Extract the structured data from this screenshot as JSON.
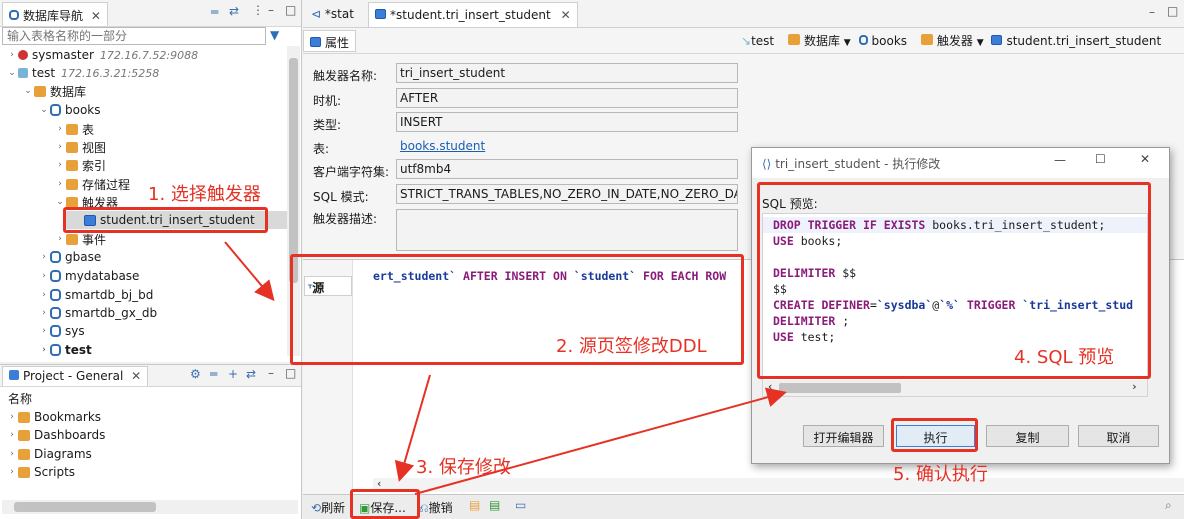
{
  "navigator": {
    "tab_title": "数据库导航",
    "filter_placeholder": "输入表格名称的一部分",
    "tree": {
      "sysmaster": {
        "name": "sysmaster",
        "host": "172.16.7.52:9088"
      },
      "test": {
        "name": "test",
        "host": "172.16.3.21:5258"
      },
      "databases": "数据库",
      "books": "books",
      "tables": "表",
      "views": "视图",
      "indexes": "索引",
      "procedures": "存储过程",
      "triggers": "触发器",
      "trigger_item": "student.tri_insert_student",
      "events": "事件",
      "other_dbs": [
        "gbase",
        "mydatabase",
        "smartdb_bj_bd",
        "smartdb_gx_db",
        "sys",
        "test"
      ]
    }
  },
  "project": {
    "tab_title": "Project - General",
    "column_header": "名称",
    "items": [
      "Bookmarks",
      "Dashboards",
      "Diagrams",
      "Scripts"
    ]
  },
  "editor": {
    "tabs": [
      "*stat",
      "*student.tri_insert_student"
    ],
    "subtab": "属性",
    "breadcrumb": {
      "conn": "test",
      "db_folder": "数据库",
      "db": "books",
      "trig_folder": "触发器",
      "trigger": "student.tri_insert_student"
    },
    "fields": {
      "name_label": "触发器名称:",
      "name_value": "tri_insert_student",
      "timing_label": "时机:",
      "timing_value": "AFTER",
      "type_label": "类型:",
      "type_value": "INSERT",
      "table_label": "表:",
      "table_value": "books.student",
      "charset_label": "客户端字符集:",
      "charset_value": "utf8mb4",
      "sqlmode_label": "SQL 模式:",
      "sqlmode_value": "STRICT_TRANS_TABLES,NO_ZERO_IN_DATE,NO_ZERO_DAT",
      "desc_label": "触发器描述:"
    },
    "source_tab": "源",
    "ddl_line": {
      "part1": "ert_student`",
      "part2": " AFTER INSERT ON ",
      "part3": "`student`",
      "part4": " FOR EACH ROW"
    },
    "toolbar": {
      "refresh": "刷新",
      "save": "保存...",
      "revert": "撤销"
    }
  },
  "dialog": {
    "title": "tri_insert_student - 执行修改",
    "preview_label": "SQL 预览:",
    "sql": {
      "l1_kw": "DROP TRIGGER IF EXISTS",
      "l1_rest": " books.tri_insert_student;",
      "l2_kw": "USE",
      "l2_rest": " books;",
      "l4_kw": "DELIMITER",
      "l4_rest": " $$",
      "l5": "$$",
      "l6_kw": "CREATE DEFINER",
      "l6_a": "=",
      "l6_user": "`sysdba`",
      "l6_b": "@",
      "l6_host": "`%`",
      "l6_kw2": " TRIGGER ",
      "l6_name": "`tri_insert_stud",
      "l7_kw": "DELIMITER",
      "l7_rest": " ;",
      "l8_kw": "USE",
      "l8_rest": " test;"
    },
    "buttons": {
      "open_editor": "打开编辑器",
      "execute": "执行",
      "copy": "复制",
      "cancel": "取消"
    }
  },
  "annotations": {
    "step1": "1. 选择触发器",
    "step2": "2. 源页签修改DDL",
    "step3": "3. 保存修改",
    "step4": "4. SQL 预览",
    "step5": "5. 确认执行",
    "color": "#e53225"
  }
}
